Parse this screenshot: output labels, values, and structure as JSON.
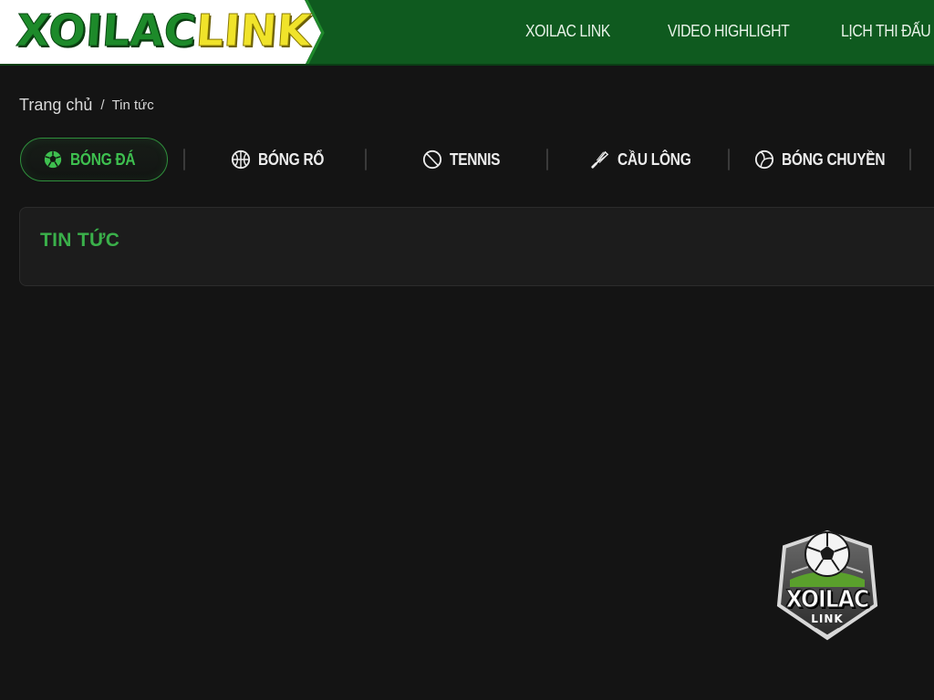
{
  "header": {
    "logo": {
      "part1": "XOILAC",
      "part2": "LINK"
    },
    "nav": [
      {
        "label": "XOILAC LINK"
      },
      {
        "label": "VIDEO HIGHLIGHT"
      },
      {
        "label": "LỊCH THI ĐẤU"
      }
    ],
    "colors": {
      "background": "#0f5a1f",
      "logo_green": "#1d8a2a",
      "logo_yellow": "#f0e32a"
    }
  },
  "breadcrumb": {
    "home": "Trang chủ",
    "separator": "/",
    "current": "Tin tức"
  },
  "tabs": [
    {
      "label": "BÓNG ĐÁ",
      "icon": "soccer-ball-icon",
      "active": true
    },
    {
      "label": "BÓNG RỔ",
      "icon": "basketball-icon",
      "active": false
    },
    {
      "label": "TENNIS",
      "icon": "tennis-ball-icon",
      "active": false
    },
    {
      "label": "CẦU LÔNG",
      "icon": "shuttlecock-icon",
      "active": false
    },
    {
      "label": "BÓNG CHUYỀN",
      "icon": "volleyball-icon",
      "active": false
    }
  ],
  "news": {
    "title": "TIN TỨC"
  },
  "badge": {
    "line1": "XOILAC",
    "line2": "LINK"
  },
  "colors": {
    "accent": "#3ab04a",
    "page_background": "#141414",
    "panel_background": "#1c1c1c"
  }
}
